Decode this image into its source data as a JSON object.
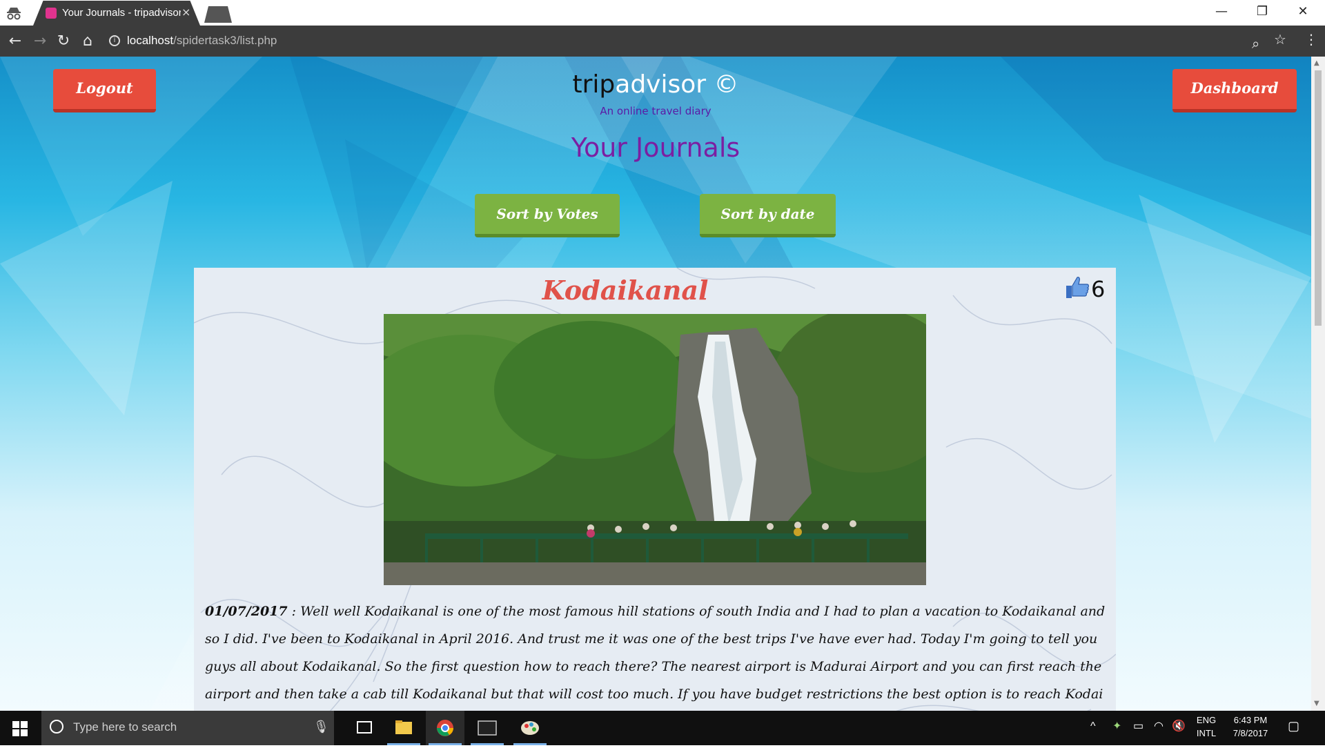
{
  "browser": {
    "tab_title": "Your Journals - tripadvisor",
    "tab_close": "×",
    "url_host": "localhost",
    "url_path": "/spidertask3/list.php",
    "window_controls": [
      "—",
      "❐",
      "✕"
    ]
  },
  "header": {
    "logout_label": "Logout",
    "dashboard_label": "Dashboard",
    "brand_part1": "trip",
    "brand_part2": "advisor ©",
    "tagline": "An online travel diary",
    "page_title": "Your Journals"
  },
  "sort": {
    "votes_label": "Sort by Votes",
    "date_label": "Sort by date"
  },
  "journal": {
    "title": "Kodaikanal",
    "votes": "6",
    "date": "01/07/2017",
    "body": " : Well well Kodaikanal is one of the most famous hill stations of south India and I had to plan a vacation to Kodaikanal and so I did. I've been to Kodaikanal in April 2016. And trust me it was one of the best trips I've have ever had. Today I'm going to tell you guys all about Kodaikanal. So the first question how to reach there? The nearest airport is Madurai Airport and you can first reach the airport and then take a cab till Kodaikanal but that will cost too much. If you have budget restrictions the best option is to reach Kodai Road railway station and then take a bus or a cab till Kodaikanal"
  },
  "taskbar": {
    "search_placeholder": "Type here to search",
    "lang_line1": "ENG",
    "lang_line2": "INTL",
    "time": "6:43 PM",
    "date": "7/8/2017"
  },
  "colors": {
    "logout_button": "#e74c3c",
    "sort_button": "#7cb342",
    "journal_title": "#e0524a",
    "page_title": "#7b1fa2"
  }
}
